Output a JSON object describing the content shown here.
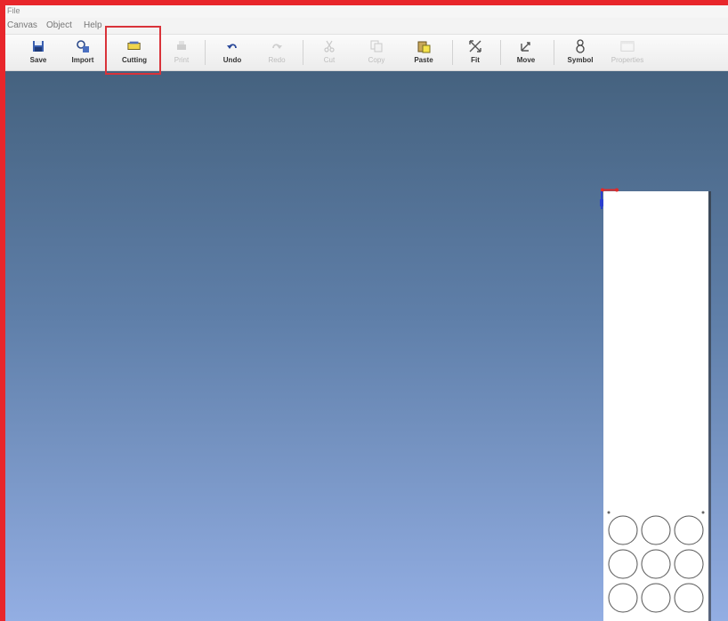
{
  "window": {
    "title": "File"
  },
  "menu": [
    "Canvas",
    "Object",
    "Help"
  ],
  "toolbar": {
    "items": [
      {
        "label": "Save",
        "icon": "save-icon",
        "enabled": true
      },
      {
        "label": "Import",
        "icon": "import-icon",
        "enabled": true
      },
      {
        "label": "Cutting",
        "icon": "cutting-icon",
        "enabled": true
      },
      {
        "label": "Print",
        "icon": "print-icon",
        "enabled": false
      },
      {
        "label": "Undo",
        "icon": "undo-icon",
        "enabled": true
      },
      {
        "label": "Redo",
        "icon": "redo-icon",
        "enabled": false
      },
      {
        "label": "Cut",
        "icon": "cut-icon",
        "enabled": false
      },
      {
        "label": "Copy",
        "icon": "copy-icon",
        "enabled": false
      },
      {
        "label": "Paste",
        "icon": "paste-icon",
        "enabled": true
      },
      {
        "label": "Fit",
        "icon": "fit-icon",
        "enabled": true
      },
      {
        "label": "Move",
        "icon": "move-icon",
        "enabled": true
      },
      {
        "label": "Symbol",
        "icon": "symbol-icon",
        "enabled": true
      },
      {
        "label": "Properties",
        "icon": "properties-icon",
        "enabled": false
      }
    ]
  },
  "colors": {
    "frame": "#e8262b",
    "highlight": "#d9333a",
    "canvas_top": "#45627f",
    "canvas_bottom": "#93aee3",
    "sheet": "#ffffff"
  }
}
